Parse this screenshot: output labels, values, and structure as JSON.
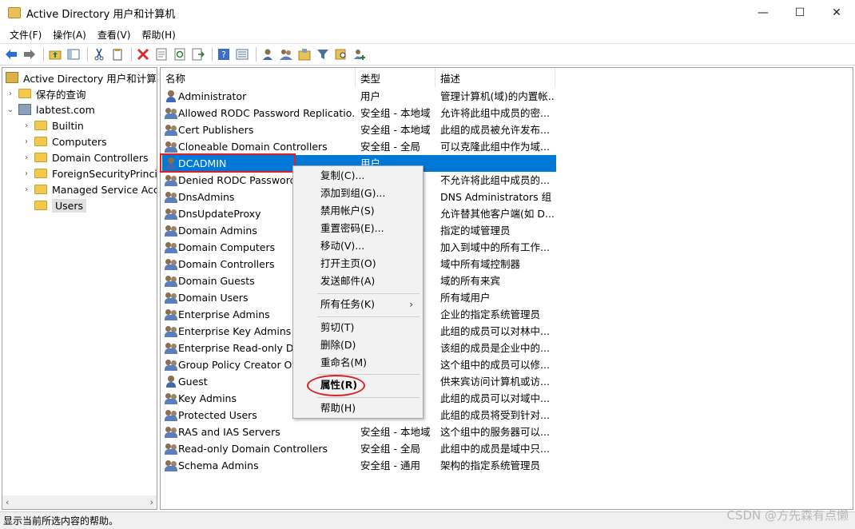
{
  "window": {
    "title": "Active Directory 用户和计算机",
    "minimize": "—",
    "maximize": "☐",
    "close": "✕"
  },
  "menu": [
    "文件(F)",
    "操作(A)",
    "查看(V)",
    "帮助(H)"
  ],
  "toolbar_icons": [
    "back-arrow-icon",
    "forward-arrow-icon",
    "up-folder-icon",
    "show-tree-icon",
    "cut-icon",
    "copy-icon",
    "delete-icon",
    "properties-icon",
    "refresh-icon",
    "export-icon",
    "help-icon",
    "view-icon",
    "new-user-icon",
    "new-group-icon",
    "new-ou-icon",
    "filter-icon",
    "find-icon",
    "add-to-group-icon"
  ],
  "tree": {
    "root": "Active Directory 用户和计算机",
    "saved_queries": "保存的查询",
    "domain": "labtest.com",
    "children": [
      "Builtin",
      "Computers",
      "Domain Controllers",
      "ForeignSecurityPrincipals",
      "Managed Service Accounts",
      "Users"
    ],
    "selected": "Users"
  },
  "list": {
    "columns": [
      "名称",
      "类型",
      "描述"
    ],
    "rows": [
      {
        "name": "Administrator",
        "type": "用户",
        "desc": "管理计算机(域)的内置帐...",
        "kind": "user"
      },
      {
        "name": "Allowed RODC Password Replicatio...",
        "type": "安全组 - 本地域",
        "desc": "允许将此组中成员的密...",
        "kind": "group"
      },
      {
        "name": "Cert Publishers",
        "type": "安全组 - 本地域",
        "desc": "此组的成员被允许发布...",
        "kind": "group"
      },
      {
        "name": "Cloneable Domain Controllers",
        "type": "安全组 - 全局",
        "desc": "可以克隆此组中作为域...",
        "kind": "group"
      },
      {
        "name": "DCADMIN",
        "type": "用户",
        "desc": "",
        "kind": "user",
        "selected": true
      },
      {
        "name": "Denied RODC Password",
        "type": "域",
        "desc": "不允许将此组中成员的...",
        "kind": "group"
      },
      {
        "name": "DnsAdmins",
        "type": "",
        "desc": "DNS Administrators 组",
        "kind": "group"
      },
      {
        "name": "DnsUpdateProxy",
        "type": "",
        "desc": "允许替其他客户端(如 D...",
        "kind": "group"
      },
      {
        "name": "Domain Admins",
        "type": "",
        "desc": "指定的域管理员",
        "kind": "group"
      },
      {
        "name": "Domain Computers",
        "type": "",
        "desc": "加入到域中的所有工作...",
        "kind": "group"
      },
      {
        "name": "Domain Controllers",
        "type": "",
        "desc": "域中所有域控制器",
        "kind": "group"
      },
      {
        "name": "Domain Guests",
        "type": "",
        "desc": "域的所有来宾",
        "kind": "group"
      },
      {
        "name": "Domain Users",
        "type": "",
        "desc": "所有域用户",
        "kind": "group"
      },
      {
        "name": "Enterprise Admins",
        "type": "",
        "desc": "企业的指定系统管理员",
        "kind": "group"
      },
      {
        "name": "Enterprise Key Admins",
        "type": "",
        "desc": "此组的成员可以对林中...",
        "kind": "group"
      },
      {
        "name": "Enterprise Read-only Do",
        "type": "",
        "desc": "该组的成员是企业中的...",
        "kind": "group"
      },
      {
        "name": "Group Policy Creator Ow",
        "type": "",
        "desc": "这个组中的成员可以修...",
        "kind": "group"
      },
      {
        "name": "Guest",
        "type": "",
        "desc": "供来宾访问计算机或访...",
        "kind": "user"
      },
      {
        "name": "Key Admins",
        "type": "",
        "desc": "此组的成员可以对域中...",
        "kind": "group"
      },
      {
        "name": "Protected Users",
        "type": "",
        "desc": "此组的成员将受到针对...",
        "kind": "group"
      },
      {
        "name": "RAS and IAS Servers",
        "type": "安全组 - 本地域",
        "desc": "这个组中的服务器可以...",
        "kind": "group"
      },
      {
        "name": "Read-only Domain Controllers",
        "type": "安全组 - 全局",
        "desc": "此组中的成员是域中只...",
        "kind": "group"
      },
      {
        "name": "Schema Admins",
        "type": "安全组 - 通用",
        "desc": "架构的指定系统管理员",
        "kind": "group"
      }
    ]
  },
  "context_menu": {
    "items": [
      "复制(C)...",
      "添加到组(G)...",
      "禁用帐户(S)",
      "重置密码(E)...",
      "移动(V)...",
      "打开主页(O)",
      "发送邮件(A)",
      "所有任务(K)",
      "剪切(T)",
      "删除(D)",
      "重命名(M)",
      "属性(R)",
      "帮助(H)"
    ],
    "submenu_arrow": "›"
  },
  "status": "显示当前所选内容的帮助。",
  "watermark": "CSDN @方先森有点懒",
  "colors": {
    "selection": "#0078d7",
    "highlight": "#e02020"
  }
}
